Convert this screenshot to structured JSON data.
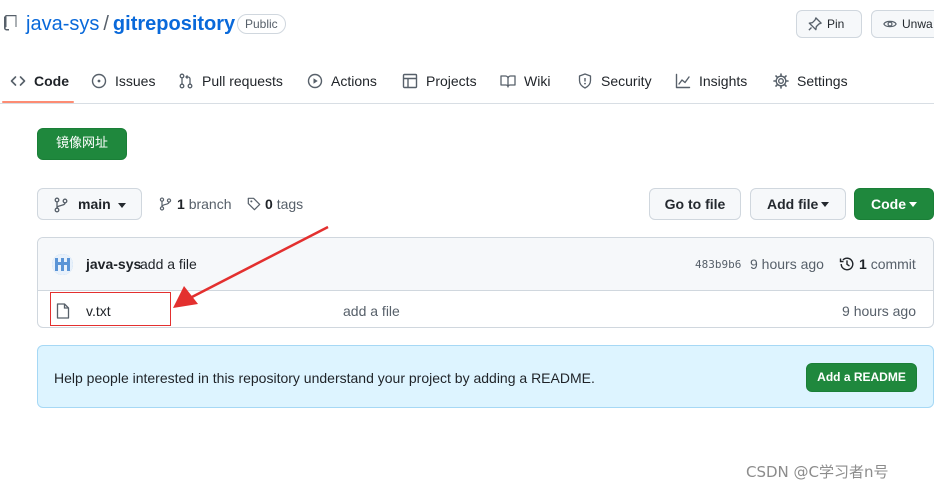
{
  "repo": {
    "owner": "java-sys",
    "separator": "/",
    "name": "gitrepository",
    "visibility": "Public"
  },
  "header_buttons": {
    "pin": "Pin",
    "unwatch": "Unwa"
  },
  "tabs": [
    {
      "label": "Code",
      "icon": "code-icon",
      "selected": true
    },
    {
      "label": "Issues",
      "icon": "issue-icon"
    },
    {
      "label": "Pull requests",
      "icon": "pull-request-icon"
    },
    {
      "label": "Actions",
      "icon": "play-icon"
    },
    {
      "label": "Projects",
      "icon": "table-icon"
    },
    {
      "label": "Wiki",
      "icon": "book-icon"
    },
    {
      "label": "Security",
      "icon": "shield-icon"
    },
    {
      "label": "Insights",
      "icon": "graph-icon"
    },
    {
      "label": "Settings",
      "icon": "gear-icon"
    }
  ],
  "mirror_button": "镜像网址",
  "branch": {
    "current": "main",
    "branches_count": "1",
    "branches_label": "branch",
    "tags_count": "0",
    "tags_label": "tags"
  },
  "actions": {
    "go_to_file": "Go to file",
    "add_file": "Add file",
    "code": "Code"
  },
  "latest_commit": {
    "author": "java-sys",
    "message": "add a file",
    "hash": "483b9b6",
    "time": "9 hours ago",
    "count": "1",
    "count_label": "commit"
  },
  "files": [
    {
      "name": "v.txt",
      "message": "add a file",
      "time": "9 hours ago"
    }
  ],
  "readme_banner": {
    "text": "Help people interested in this repository understand your project by adding a README.",
    "button": "Add a README"
  },
  "watermark": "CSDN @C学习者n号",
  "colors": {
    "link": "#0969da",
    "primary_button": "#1f883d",
    "tab_underline": "#fd8c73",
    "annotation_red": "#e3302f",
    "banner_bg": "#ddf4ff"
  }
}
